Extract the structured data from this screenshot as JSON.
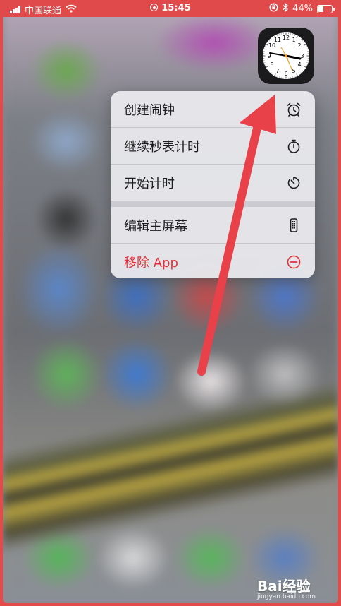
{
  "status_bar": {
    "carrier": "中国联通",
    "time": "15:45",
    "battery": "44%",
    "battery_level": 0.44
  },
  "app_icon": {
    "name": "clock-app-icon"
  },
  "menu": {
    "items": [
      {
        "label": "创建闹钟",
        "icon": "alarm-clock-icon"
      },
      {
        "label": "继续秒表计时",
        "icon": "stopwatch-icon"
      },
      {
        "label": "开始计时",
        "icon": "timer-icon"
      },
      {
        "label": "编辑主屏幕",
        "icon": "phone-edit-icon"
      },
      {
        "label": "移除 App",
        "icon": "minus-circle-icon",
        "color": "#e0333a"
      }
    ]
  },
  "annotation": {
    "color": "#e8414a",
    "type": "arrow"
  },
  "watermark": {
    "brand": "Bai经验",
    "url": "jingyan.baidu.com"
  },
  "colors": {
    "status_bar_bg": "#e04a4a",
    "danger": "#e0333a"
  }
}
